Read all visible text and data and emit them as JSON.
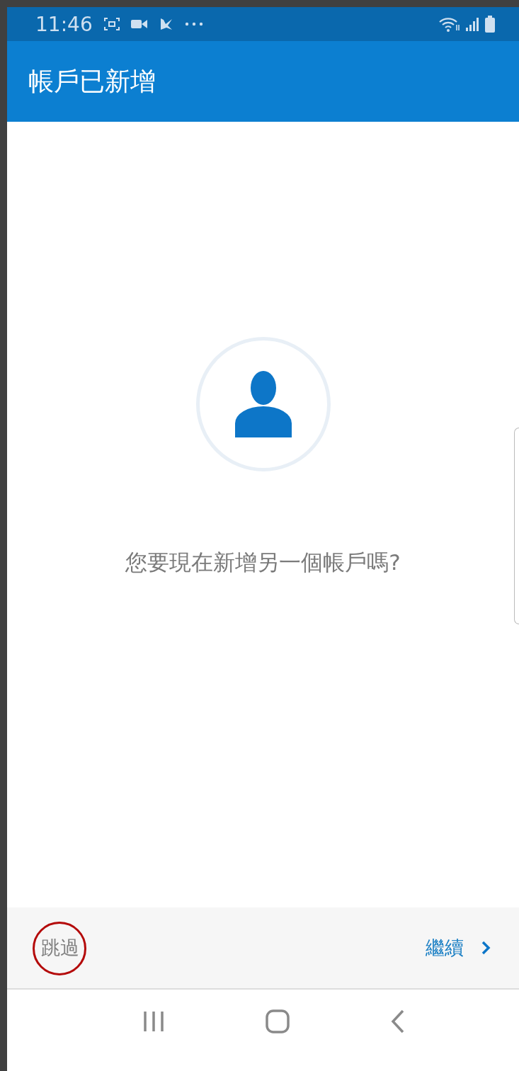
{
  "status_bar": {
    "time": "11:46"
  },
  "app_bar": {
    "title": "帳戶已新增"
  },
  "prompt": "您要現在新增另一個帳戶嗎?",
  "footer": {
    "skip": "跳過",
    "skip_highlighted": true,
    "continue": "繼續"
  }
}
